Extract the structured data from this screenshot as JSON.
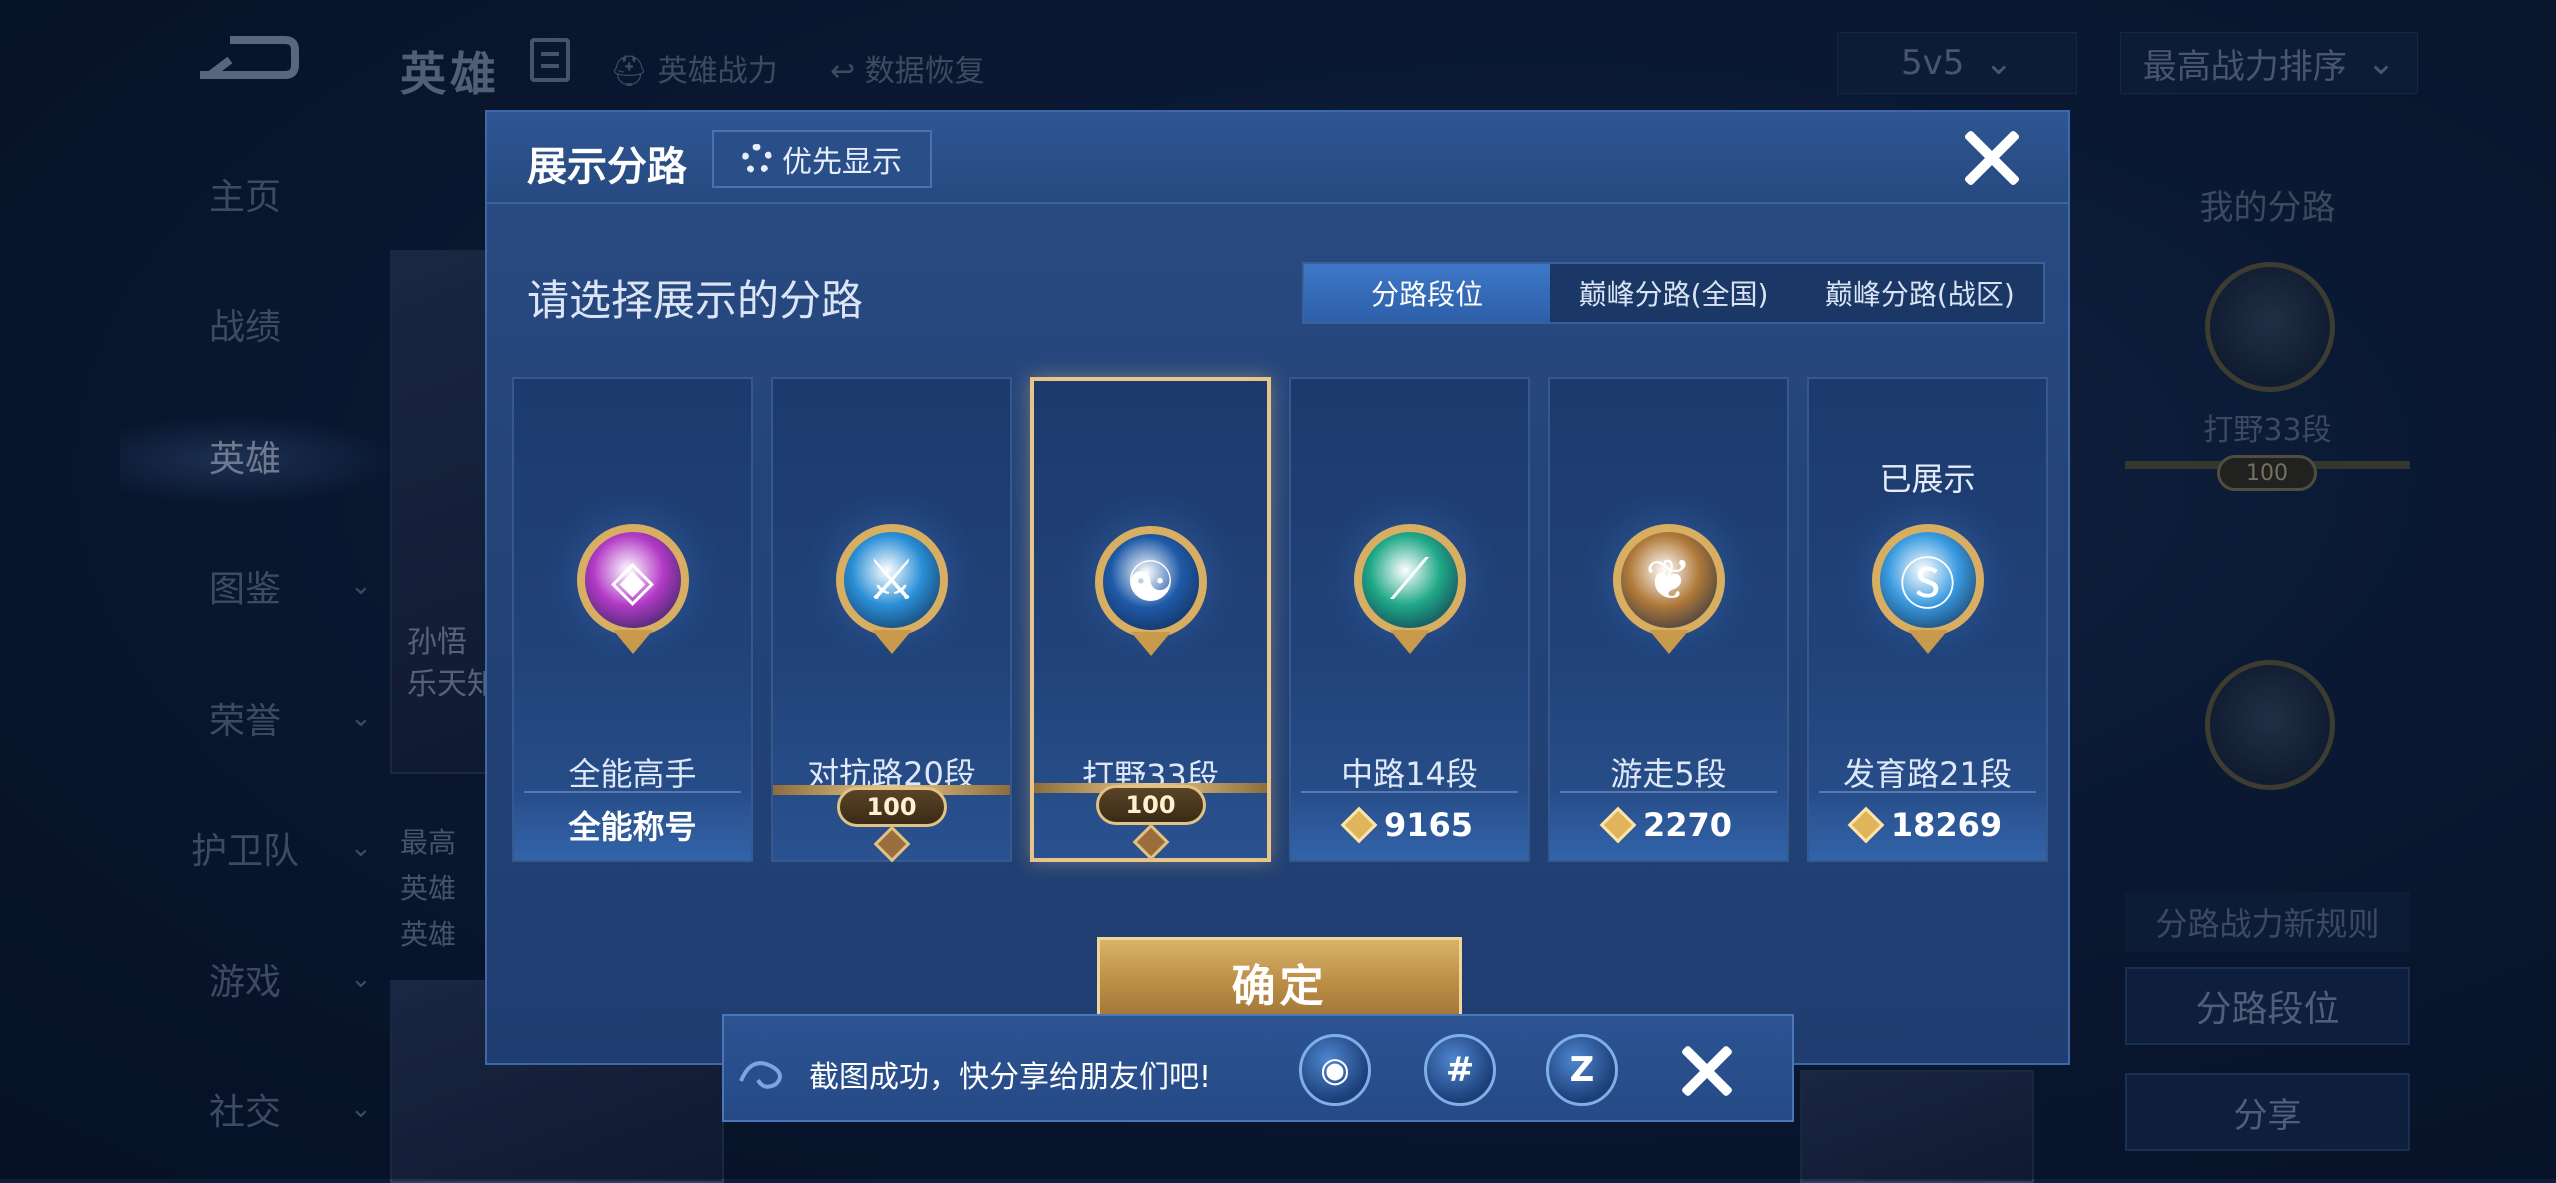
{
  "topbar": {
    "title": "英雄",
    "links": [
      "英雄战力",
      "数据恢复"
    ],
    "mode_dropdown": "5v5",
    "sort_dropdown": "最高战力排序"
  },
  "nav": {
    "items": [
      {
        "label": "主页",
        "chevron": false
      },
      {
        "label": "战绩",
        "chevron": false
      },
      {
        "label": "英雄",
        "chevron": false,
        "active": true
      },
      {
        "label": "图鉴",
        "chevron": true
      },
      {
        "label": "荣誉",
        "chevron": true
      },
      {
        "label": "护卫队",
        "chevron": true
      },
      {
        "label": "游戏",
        "chevron": true
      },
      {
        "label": "社交",
        "chevron": true
      }
    ]
  },
  "background_hero": {
    "name_lines": [
      "孙悟",
      "乐天知"
    ],
    "info_lines": [
      "最高",
      "英雄",
      "英雄"
    ]
  },
  "right_panel": {
    "title": "我的分路",
    "current_lane": "打野33段",
    "current_score": "100",
    "rules_button": "分路战力新规则",
    "rank_button": "分路段位",
    "share_button": "分享"
  },
  "dialog": {
    "title": "展示分路",
    "priority_button": "优先显示",
    "subtitle": "请选择展示的分路",
    "tabs": [
      "分路段位",
      "巅峰分路(全国)",
      "巅峰分路(战区)"
    ],
    "active_tab": 0,
    "confirm_label": "确定",
    "cards": [
      {
        "name": "全能高手",
        "foot_type": "text",
        "foot": "全能称号",
        "color": "#b23ac6",
        "icon": "allround-icon",
        "glyph": "◈"
      },
      {
        "name": "对抗路20段",
        "foot_type": "plaque",
        "foot": "100",
        "color": "#2a8fd6",
        "icon": "crossed-swords-icon",
        "glyph": "⚔"
      },
      {
        "name": "打野33段",
        "foot_type": "plaque",
        "foot": "100",
        "color": "#1f5aa8",
        "icon": "dragon-icon",
        "glyph": "☯",
        "selected": true
      },
      {
        "name": "中路14段",
        "foot_type": "power",
        "foot": "9165",
        "color": "#20a888",
        "icon": "mid-lane-icon",
        "glyph": "⟋"
      },
      {
        "name": "游走5段",
        "foot_type": "power",
        "foot": "2270",
        "color": "#b07a3a",
        "icon": "wings-icon",
        "glyph": "❦"
      },
      {
        "name": "发育路21段",
        "foot_type": "power",
        "foot": "18269",
        "color": "#3a9be0",
        "icon": "marksman-icon",
        "glyph": "Ⓢ",
        "shown_label": "已展示"
      }
    ]
  },
  "toast": {
    "message": "截图成功，快分享给朋友们吧!",
    "share_targets": [
      {
        "icon": "qq-icon",
        "glyph": "◉"
      },
      {
        "icon": "wechat-moments-icon",
        "glyph": "#"
      },
      {
        "icon": "qzone-icon",
        "glyph": "Z"
      }
    ]
  }
}
